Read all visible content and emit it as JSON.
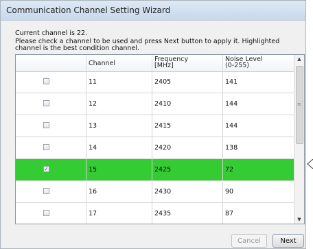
{
  "window": {
    "title": "Communication Channel Setting Wizard"
  },
  "intro": {
    "line1": "Current channel is 22.",
    "line2": "Please check a channel to be used and press Next button to apply it.  Highlighted",
    "line3": "channel is the best condition channel."
  },
  "table": {
    "columns": {
      "channel": "Channel",
      "frequency_1": "Frequency",
      "frequency_2": "[MHz]",
      "noise_1": "Noise Level",
      "noise_2": "(0-255)"
    },
    "rows": [
      {
        "checked": false,
        "channel": "11",
        "frequency": "2405",
        "noise": "141"
      },
      {
        "checked": false,
        "channel": "12",
        "frequency": "2410",
        "noise": "144"
      },
      {
        "checked": false,
        "channel": "13",
        "frequency": "2415",
        "noise": "144"
      },
      {
        "checked": false,
        "channel": "14",
        "frequency": "2420",
        "noise": "138"
      },
      {
        "checked": true,
        "channel": "15",
        "frequency": "2425",
        "noise": "72",
        "highlighted": true
      },
      {
        "checked": false,
        "channel": "16",
        "frequency": "2430",
        "noise": "90"
      },
      {
        "checked": false,
        "channel": "17",
        "frequency": "2435",
        "noise": "87"
      }
    ],
    "highlight_color": "#33cc33"
  },
  "buttons": {
    "cancel": "Cancel",
    "next": "Next"
  },
  "icons": {
    "checkbox_checked": "✓",
    "scroll_up": "▲",
    "scroll_down": "▼",
    "grip": "≡"
  }
}
